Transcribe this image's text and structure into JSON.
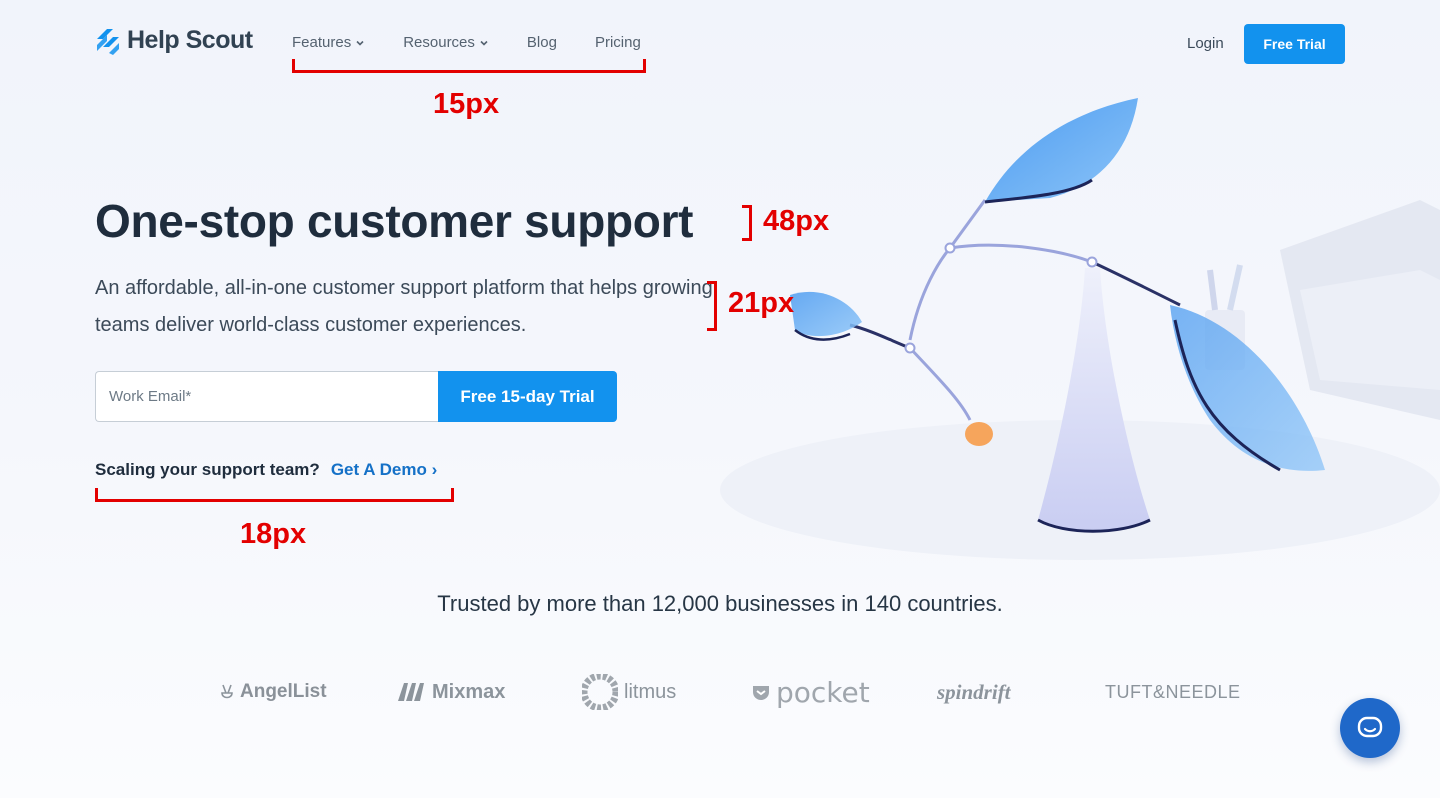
{
  "brand": {
    "name": "Help Scout",
    "accent": "#1292ee",
    "annotation_color": "#e30000"
  },
  "nav": {
    "items": [
      {
        "label": "Features",
        "has_dropdown": true
      },
      {
        "label": "Resources",
        "has_dropdown": true
      },
      {
        "label": "Blog",
        "has_dropdown": false
      },
      {
        "label": "Pricing",
        "has_dropdown": false
      }
    ],
    "login": "Login",
    "trial_button": "Free Trial"
  },
  "hero": {
    "title": "One-stop customer support",
    "subtitle": "An affordable, all-in-one customer support platform that helps growing teams deliver world-class customer experiences.",
    "email_placeholder": "Work Email*",
    "cta": "Free 15-day Trial",
    "demo_question": "Scaling your support team?",
    "demo_link": "Get A Demo ›"
  },
  "annotations": {
    "nav_size": "15px",
    "title_size": "48px",
    "subtitle_size": "21px",
    "demo_size": "18px"
  },
  "trusted": {
    "text": "Trusted by more than 12,000 businesses in 140 countries.",
    "logos": [
      "AngelList",
      "Mixmax",
      "litmus",
      "pocket",
      "spindrift",
      "TUFT&NEEDLE"
    ]
  },
  "chat": {
    "icon": "chat-icon"
  }
}
